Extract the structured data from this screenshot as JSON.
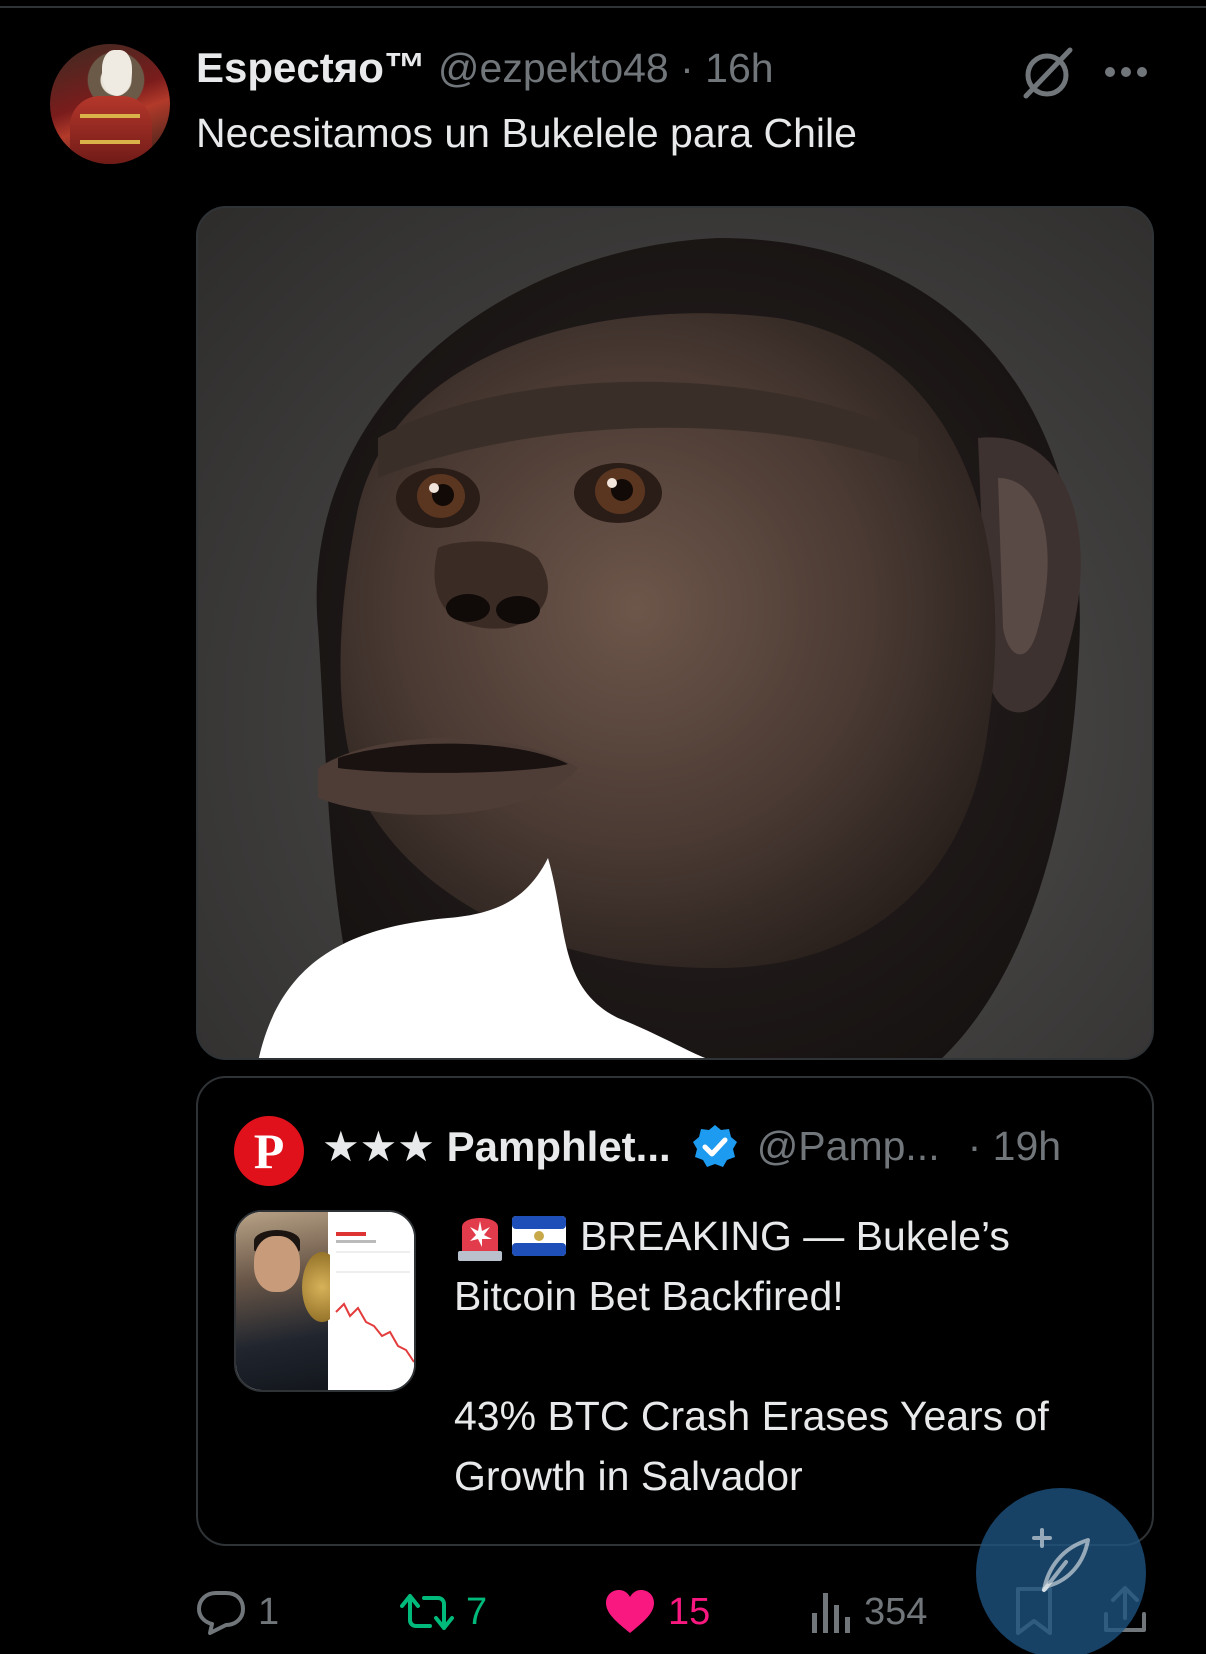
{
  "tweet": {
    "display_name": "Espectяo™",
    "handle": "@ezpekto48",
    "time": "16h",
    "text": "Necesitamos un Bukelele para Chile"
  },
  "quote": {
    "name": "★★★ Pamphlet...",
    "handle": "@Pamp...",
    "time": "19h",
    "line1": "BREAKING — Bukele’s",
    "line2": "Bitcoin Bet Backfired!",
    "line3": "43% BTC Crash Erases Years of",
    "line4": "Growth in Salvador"
  },
  "actions": {
    "replies": "1",
    "retweets": "7",
    "likes": "15",
    "views": "354"
  },
  "colors": {
    "retweet": "#00ba7c",
    "like": "#f91880",
    "verified": "#1d9bf0",
    "brand_logo": "#e0111b"
  },
  "icons": [
    "grok-icon",
    "more-icon",
    "verified-badge-icon",
    "siren-emoji",
    "el-salvador-flag-emoji",
    "reply-icon",
    "retweet-icon",
    "heart-icon",
    "views-icon",
    "bookmark-icon",
    "share-icon",
    "compose-icon"
  ]
}
